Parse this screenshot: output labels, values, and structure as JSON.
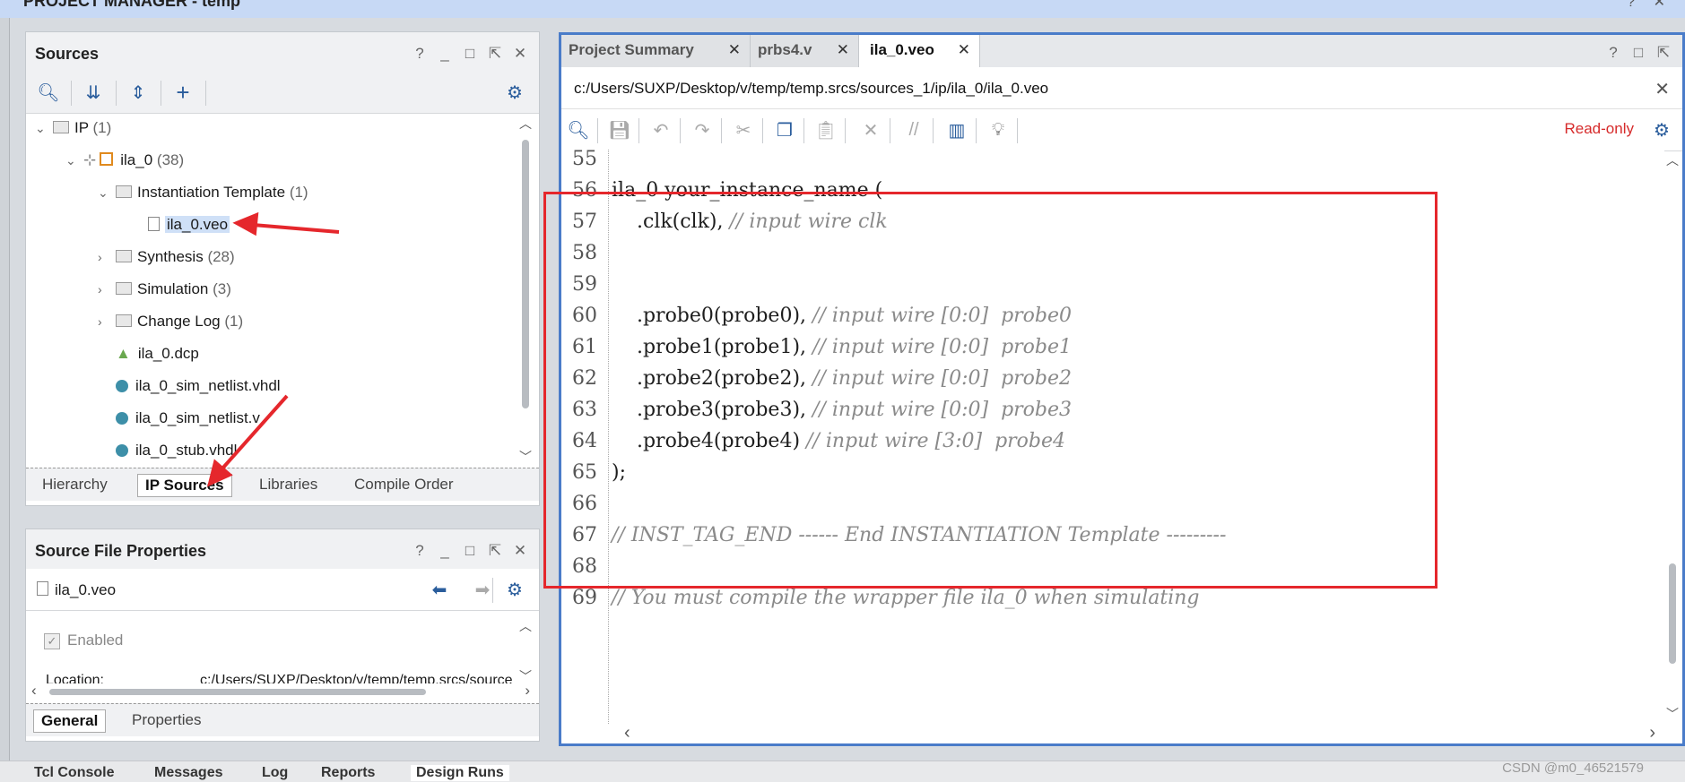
{
  "window": {
    "title": "PROJECT MANAGER - temp"
  },
  "sources_panel": {
    "title": "Sources",
    "controls": [
      "?",
      "_",
      "□",
      "⇱",
      "✕"
    ],
    "tree": [
      {
        "label": "IP",
        "count": "(1)"
      },
      {
        "label": "ila_0",
        "count": "(38)"
      },
      {
        "label": "Instantiation Template",
        "count": "(1)"
      },
      {
        "label": "ila_0.veo",
        "count": ""
      },
      {
        "label": "Synthesis",
        "count": "(28)"
      },
      {
        "label": "Simulation",
        "count": "(3)"
      },
      {
        "label": "Change Log",
        "count": "(1)"
      },
      {
        "label": "ila_0.dcp",
        "count": ""
      },
      {
        "label": "ila_0_sim_netlist.vhdl",
        "count": ""
      },
      {
        "label": "ila_0_sim_netlist.v",
        "count": ""
      },
      {
        "label": "ila_0_stub.vhdl",
        "count": ""
      }
    ],
    "tabs": [
      "Hierarchy",
      "IP Sources",
      "Libraries",
      "Compile Order"
    ]
  },
  "props_panel": {
    "title": "Source File Properties",
    "file": "ila_0.veo",
    "enabled_label": "Enabled",
    "location_label": "Location:",
    "location_value": "c:/Users/SUXP/Desktop/v/temp/temp.srcs/source",
    "tabs": [
      "General",
      "Properties"
    ]
  },
  "editor": {
    "tabs": [
      "Project Summary",
      "prbs4.v",
      "ila_0.veo"
    ],
    "path": "c:/Users/SUXP/Desktop/v/temp/temp.srcs/sources_1/ip/ila_0/ila_0.veo",
    "readonly": "Read-only",
    "lines": [
      {
        "n": "55",
        "code": "",
        "comment": ""
      },
      {
        "n": "56",
        "code": "ila_0 your_instance_name (",
        "comment": ""
      },
      {
        "n": "57",
        "code": "    .clk(clk), ",
        "comment": "// input wire clk"
      },
      {
        "n": "58",
        "code": "",
        "comment": ""
      },
      {
        "n": "59",
        "code": "",
        "comment": ""
      },
      {
        "n": "60",
        "code": "    .probe0(probe0), ",
        "comment": "// input wire [0:0]  probe0"
      },
      {
        "n": "61",
        "code": "    .probe1(probe1), ",
        "comment": "// input wire [0:0]  probe1"
      },
      {
        "n": "62",
        "code": "    .probe2(probe2), ",
        "comment": "// input wire [0:0]  probe2"
      },
      {
        "n": "63",
        "code": "    .probe3(probe3), ",
        "comment": "// input wire [0:0]  probe3"
      },
      {
        "n": "64",
        "code": "    .probe4(probe4) ",
        "comment": "// input wire [3:0]  probe4"
      },
      {
        "n": "65",
        "code": ");",
        "comment": ""
      },
      {
        "n": "66",
        "code": "",
        "comment": ""
      },
      {
        "n": "67",
        "code": "",
        "comment": "// INST_TAG_END ------ End INSTANTIATION Template ---------"
      },
      {
        "n": "68",
        "code": "",
        "comment": ""
      },
      {
        "n": "69",
        "code": "",
        "comment": "// You must compile the wrapper file ila_0 when simulating"
      }
    ]
  },
  "bottom_tabs": [
    "Tcl Console",
    "Messages",
    "Log",
    "Reports",
    "Design Runs"
  ],
  "watermark": "CSDN @m0_46521579",
  "colors": {
    "accent": "#4a7cc9",
    "highlight_box": "#e5272c",
    "readonly": "#d62b2b"
  }
}
